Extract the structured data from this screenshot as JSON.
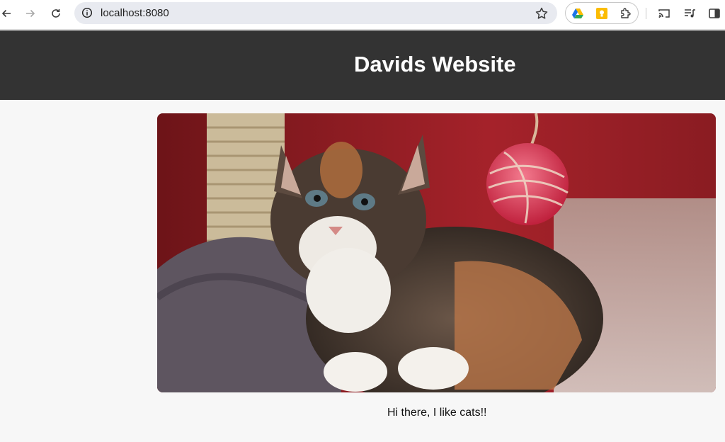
{
  "browser": {
    "url": "localhost:8080",
    "icons": [
      "back-icon",
      "forward-icon",
      "reload-icon",
      "info-icon",
      "bookmark-star-icon",
      "google-drive-icon",
      "keep-icon",
      "extensions-icon",
      "cast-icon",
      "media-queue-icon",
      "side-panel-icon"
    ]
  },
  "page": {
    "title": "Davids Website",
    "caption": "Hi there, I like cats!!",
    "header_color": "#333333",
    "background_color": "#f7f7f7"
  }
}
